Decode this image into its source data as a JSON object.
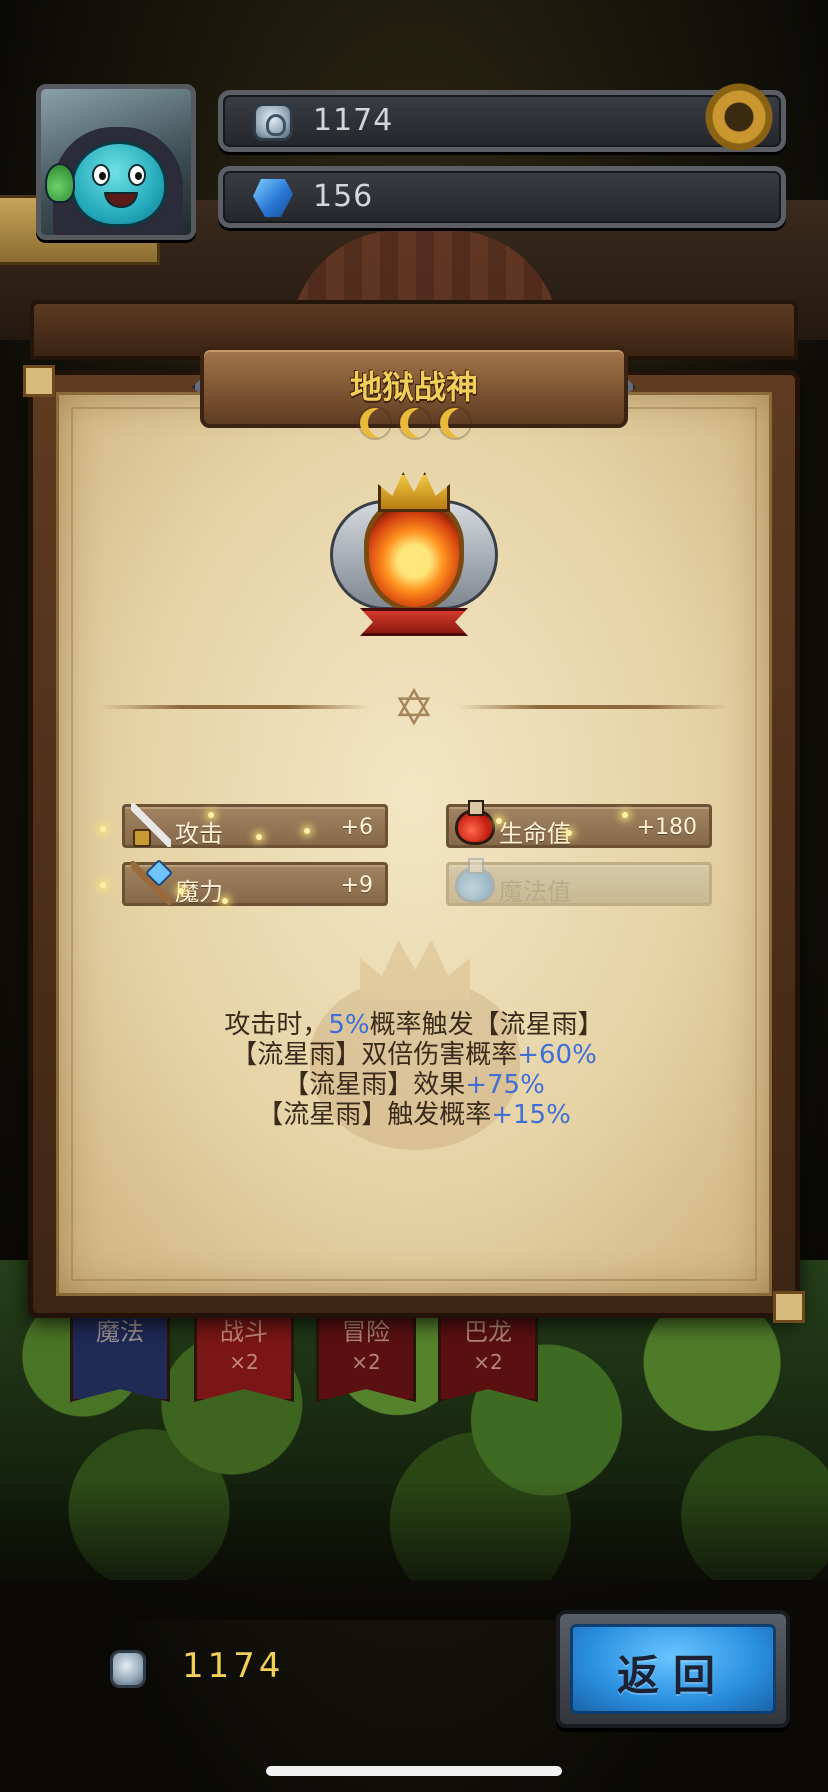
{
  "hud": {
    "tokens": "1174",
    "gems": "156",
    "settings_icon": "gear-icon",
    "token_icon": "rune-token-icon",
    "gem_icon": "blue-gem-icon"
  },
  "background": {
    "banners": [
      {
        "label": "魔法",
        "mult": "",
        "color": "#1f2a55"
      },
      {
        "label": "战斗",
        "mult": "×2",
        "color": "#7a1616"
      },
      {
        "label": "冒险",
        "mult": "×2",
        "color": "#5a1010"
      },
      {
        "label": "巴龙",
        "mult": "×2",
        "color": "#5a1010"
      }
    ]
  },
  "card": {
    "title": "地狱战神",
    "rank_moons": 3,
    "badge_icon": "inferno-crest-icon",
    "stats": [
      {
        "label": "攻击",
        "value": "+6",
        "icon": "sword-icon",
        "active": true
      },
      {
        "label": "生命值",
        "value": "+180",
        "icon": "red-potion-icon",
        "active": true
      },
      {
        "label": "魔力",
        "value": "+9",
        "icon": "magic-wand-icon",
        "active": true
      },
      {
        "label": "魔法值",
        "value": "",
        "icon": "blue-potion-icon",
        "active": false
      }
    ],
    "description": {
      "line1_a": "攻击时，",
      "line1_hl": "5%",
      "line1_b": "概率触发【流星雨】",
      "line2_a": "【流星雨】双倍伤害概率",
      "line2_hl": "+60%",
      "line3_a": "【流星雨】效果",
      "line3_hl": "+75%",
      "line4_a": "【流星雨】触发概率",
      "line4_hl": "+15%"
    },
    "highlight_color": "#3f6fd6"
  },
  "footer": {
    "tokens": "1174",
    "back_label": "返回"
  }
}
